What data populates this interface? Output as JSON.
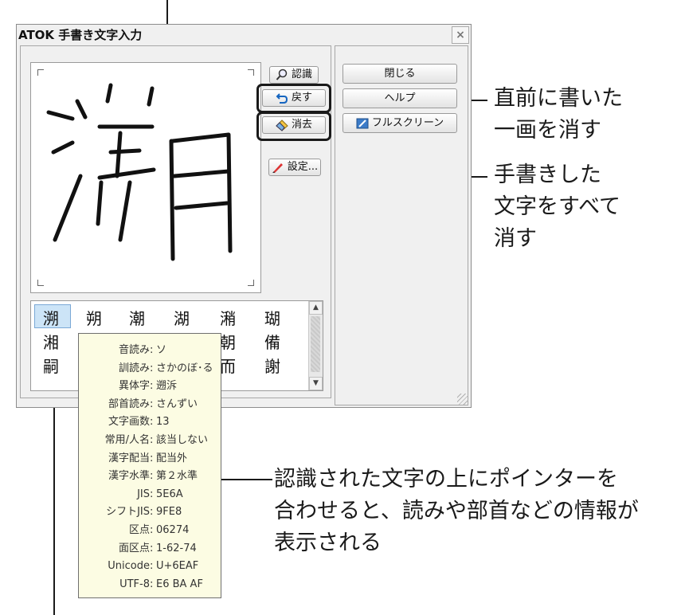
{
  "window": {
    "title": "ATOK 手書き文字入力",
    "close_symbol": "×"
  },
  "buttons": {
    "recognize": "認識",
    "undo": "戻す",
    "clear": "消去",
    "settings": "設定...",
    "close": "閉じる",
    "help": "ヘルプ",
    "fullscreen": "フルスクリーン"
  },
  "icons": {
    "recognize": "magnifier-icon",
    "undo": "undo-arrow-icon",
    "clear": "eraser-icon",
    "settings": "pen-icon",
    "fullscreen": "fullscreen-pen-icon"
  },
  "handwriting": {
    "character": "溯"
  },
  "candidates": [
    [
      "溯",
      "朔",
      "潮",
      "湖",
      "潲",
      "瑚"
    ],
    [
      "湘",
      "",
      "",
      "朝",
      "備"
    ],
    [
      "嗣",
      "",
      "",
      "而",
      "謝"
    ],
    [
      "",
      ""
    ]
  ],
  "candidate_selected": "溯",
  "candidate_partial": "朝",
  "tooltip": [
    {
      "key": "音読み",
      "value": "ソ"
    },
    {
      "key": "訓読み",
      "value": "さかのぼ･る"
    },
    {
      "key": "異体字",
      "value": "遡泝"
    },
    {
      "key": "部首読み",
      "value": "さんずい"
    },
    {
      "key": "文字画数",
      "value": "13"
    },
    {
      "key": "常用/人名",
      "value": "該当しない"
    },
    {
      "key": "漢字配当",
      "value": "配当外"
    },
    {
      "key": "漢字水準",
      "value": "第２水準"
    },
    {
      "key": "JIS",
      "value": "5E6A"
    },
    {
      "key": "シフトJIS",
      "value": "9FE8"
    },
    {
      "key": "区点",
      "value": "06274"
    },
    {
      "key": "面区点",
      "value": "1-62-74"
    },
    {
      "key": "Unicode",
      "value": "U+6EAF"
    },
    {
      "key": "UTF-8",
      "value": "E6 BA AF"
    }
  ],
  "tooltip_separator": ":",
  "annotations": {
    "undo_note": [
      "直前に書いた",
      "一画を消す"
    ],
    "clear_note": [
      "手書きした",
      "文字をすべて",
      "消す"
    ],
    "tooltip_note": [
      "認識された文字の上にポインターを",
      "合わせると、読みや部首などの情報が",
      "表示される"
    ]
  },
  "colors": {
    "tooltip_bg": "#fcfce3",
    "selected_bg": "#cce4f7",
    "undo_blue": "#1565c0"
  }
}
